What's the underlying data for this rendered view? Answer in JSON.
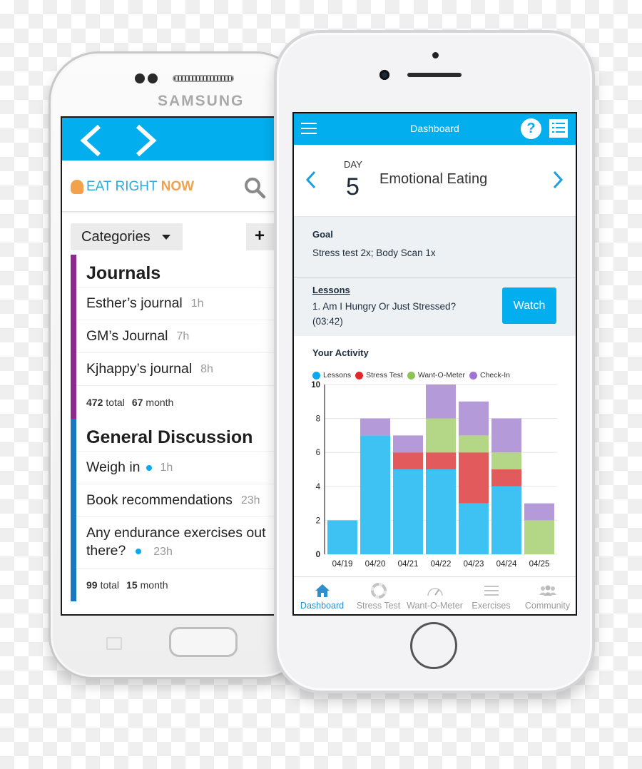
{
  "samsung": {
    "brand": "SAMSUNG",
    "app": {
      "logo": {
        "part1": "EAT RIGHT",
        "part2": "NOW"
      },
      "categories_button": "Categories",
      "add_button": "+",
      "sections": [
        {
          "title": "Journals",
          "accent": "#8e2a8e",
          "items": [
            {
              "title": "Esther’s journal",
              "time": "1h",
              "unread": false
            },
            {
              "title": "GM’s Journal",
              "time": "7h",
              "unread": false
            },
            {
              "title": "Kjhappy’s journal",
              "time": "8h",
              "unread": false
            }
          ],
          "total": "472",
          "total_label": "total",
          "month": "67",
          "month_label": "month"
        },
        {
          "title": "General Discussion",
          "accent": "#1878c0",
          "items": [
            {
              "title": "Weigh in",
              "time": "1h",
              "unread": true
            },
            {
              "title": "Book recommendations",
              "time": "23h",
              "unread": false
            },
            {
              "title": "Any endurance exercises out there?",
              "time": "23h",
              "unread": true
            }
          ],
          "total": "99",
          "total_label": "total",
          "month": "15",
          "month_label": "month"
        }
      ]
    }
  },
  "iphone": {
    "header": {
      "title": "Dashboard",
      "help": "?"
    },
    "day": {
      "label": "DAY",
      "number": "5",
      "topic": "Emotional Eating"
    },
    "goal": {
      "label": "Goal",
      "value": "Stress test 2x; Body Scan 1x"
    },
    "lessons": {
      "label": "Lessons",
      "title": "1. Am I Hungry Or Just Stressed?",
      "duration": "(03:42)",
      "watch_button": "Watch"
    },
    "activity": {
      "heading": "Your Activity"
    },
    "tabs": [
      {
        "label": "Dashboard",
        "icon": "home-icon",
        "active": true
      },
      {
        "label": "Stress Test",
        "icon": "lifebuoy-icon",
        "active": false
      },
      {
        "label": "Want-O-Meter",
        "icon": "gauge-icon",
        "active": false
      },
      {
        "label": "Exercises",
        "icon": "list-icon",
        "active": false
      },
      {
        "label": "Community",
        "icon": "people-icon",
        "active": false
      }
    ]
  },
  "chart_data": {
    "type": "bar",
    "stacked": true,
    "title": "Your Activity",
    "categories": [
      "04/19",
      "04/20",
      "04/21",
      "04/22",
      "04/23",
      "04/24",
      "04/25"
    ],
    "series": [
      {
        "name": "Lessons",
        "color": "#3ec1f3",
        "values": [
          2,
          7,
          5,
          5,
          3,
          4,
          0
        ]
      },
      {
        "name": "Stress Test",
        "color": "#e25a5c",
        "values": [
          0,
          0,
          1,
          1,
          3,
          1,
          0
        ]
      },
      {
        "name": "Want-O-Meter",
        "color": "#b3d787",
        "values": [
          0,
          0,
          0,
          2,
          1,
          1,
          2
        ]
      },
      {
        "name": "Check-In",
        "color": "#b49ad9",
        "values": [
          0,
          1,
          1,
          2,
          2,
          2,
          1
        ]
      }
    ],
    "yticks": [
      0,
      2,
      4,
      6,
      8,
      10
    ],
    "ylim": [
      0,
      10
    ],
    "grid": true,
    "legend": "top-left",
    "xlabel": "",
    "ylabel": ""
  }
}
